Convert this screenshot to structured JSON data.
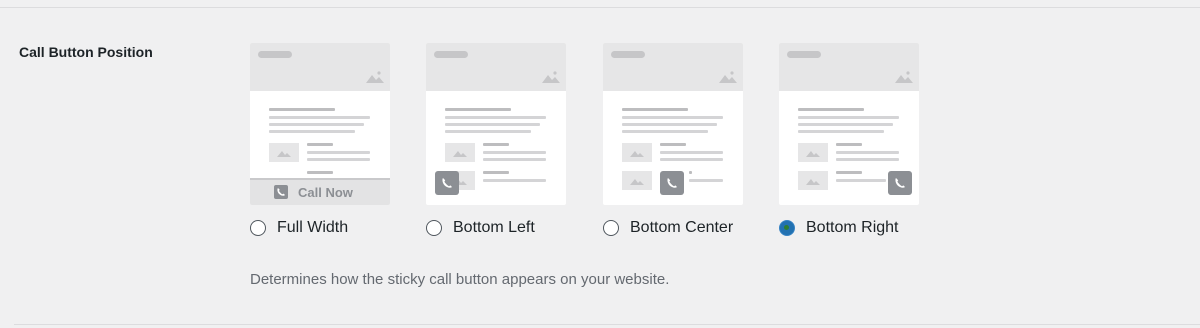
{
  "field": {
    "label": "Call Button Position",
    "help": "Determines how the sticky call button appears on your website."
  },
  "options": [
    {
      "label": "Full Width",
      "checked": false,
      "preview_text": "Call Now"
    },
    {
      "label": "Bottom Left",
      "checked": false
    },
    {
      "label": "Bottom Center",
      "checked": false
    },
    {
      "label": "Bottom Right",
      "checked": true
    }
  ],
  "colors": {
    "background": "#f0f0f1",
    "radio_checked": "#2271b1",
    "radio_dot": "#2e7d32",
    "phone_button": "#8c8f94"
  },
  "icons": {
    "phone": "phone-icon",
    "image": "image-placeholder-icon"
  }
}
